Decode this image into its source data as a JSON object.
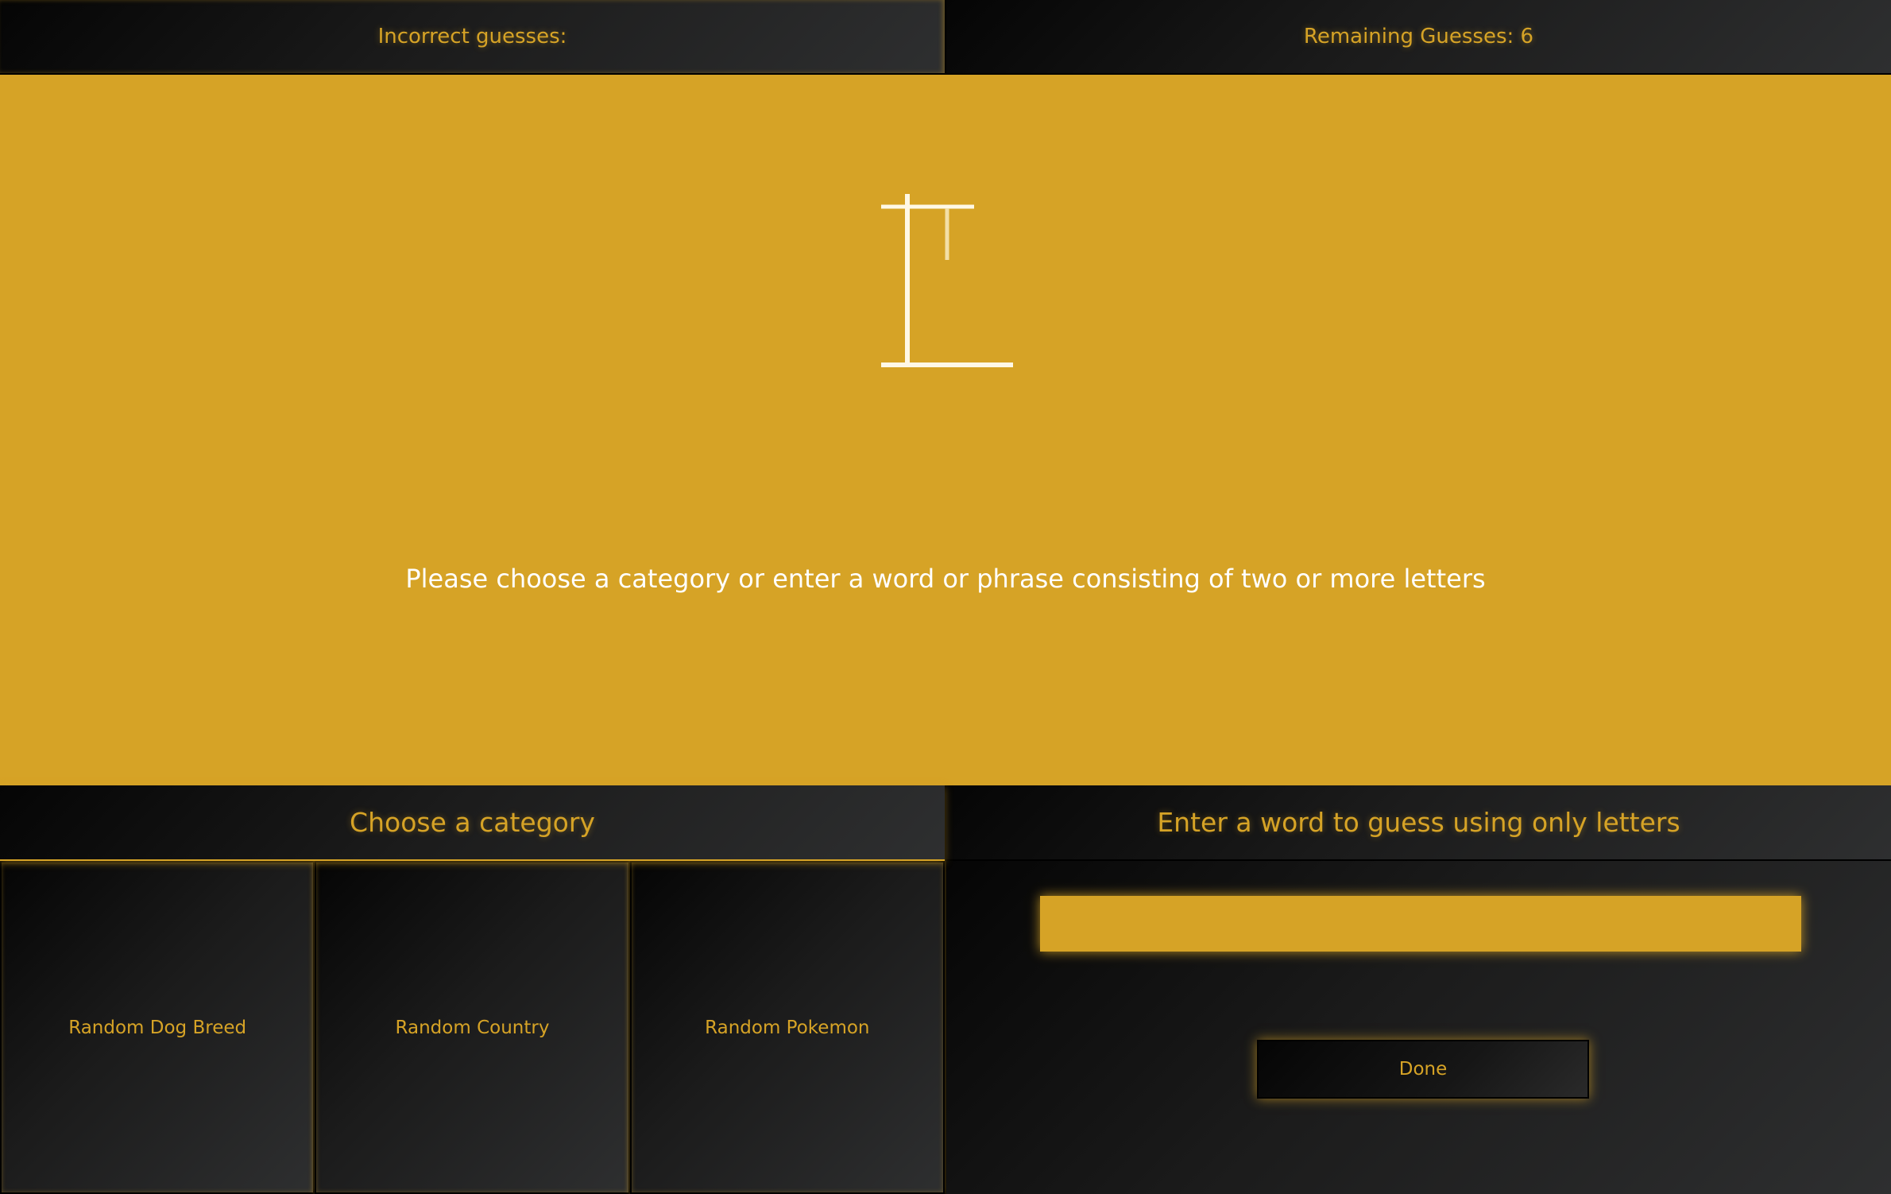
{
  "status": {
    "incorrect_label": "Incorrect guesses:",
    "remaining_label": "Remaining Guesses: 6"
  },
  "stage": {
    "message": "Please choose a category or enter a word or phrase consisting of two or more letters"
  },
  "categories": {
    "header": "Choose a category",
    "items": [
      {
        "label": "Random Dog Breed"
      },
      {
        "label": "Random Country"
      },
      {
        "label": "Random Pokemon"
      }
    ]
  },
  "word_entry": {
    "header": "Enter a word to guess using only letters",
    "input_value": "",
    "done_label": "Done"
  },
  "colors": {
    "accent": "#d6a326",
    "dark": "#1b1b1b",
    "gallows": "#fff8e6"
  }
}
